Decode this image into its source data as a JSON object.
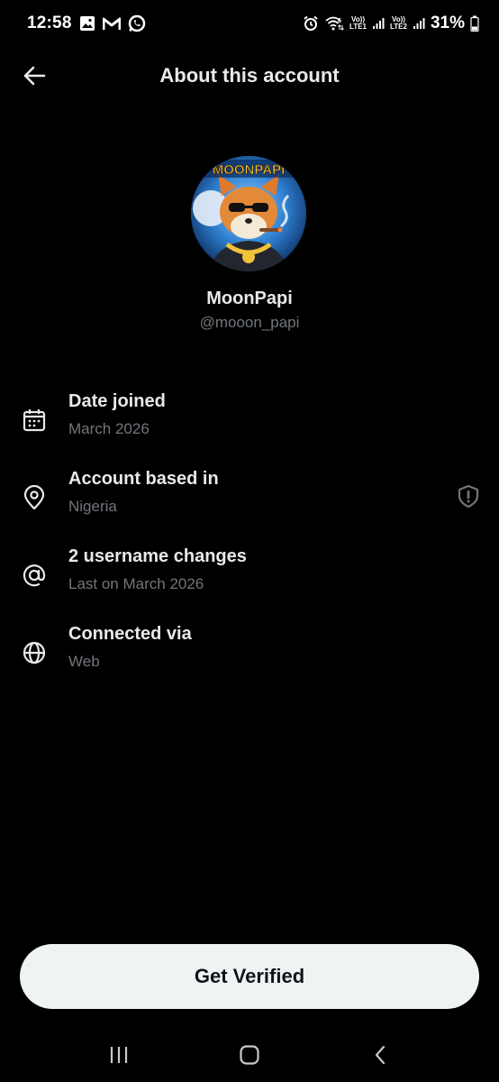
{
  "status_bar": {
    "time": "12:58",
    "network_1": "LTE1",
    "network_2": "LTE2",
    "volte_1": "Vo))",
    "volte_2": "Vo))",
    "wifi_badge": "6",
    "battery": "31%",
    "left_icons": [
      "gallery-icon",
      "gmail-icon",
      "whatsapp-icon"
    ],
    "right_icons": [
      "alarm-icon",
      "wifi-icon",
      "signal-icon",
      "battery-icon"
    ]
  },
  "header": {
    "title": "About this account",
    "back_icon": "arrow-left-icon"
  },
  "profile": {
    "display_name": "MoonPapi",
    "handle": "@mooon_papi",
    "avatar_text": "MOONPAPI"
  },
  "info": [
    {
      "icon": "calendar-icon",
      "title": "Date joined",
      "subtitle": "March 2026"
    },
    {
      "icon": "location-pin-icon",
      "title": "Account based in",
      "subtitle": "Nigeria",
      "trailing_icon": "shield-alert-icon"
    },
    {
      "icon": "at-sign-icon",
      "title": "2 username changes",
      "subtitle": "Last on March 2026"
    },
    {
      "icon": "globe-icon",
      "title": "Connected via",
      "subtitle": "Web"
    }
  ],
  "verify_button": {
    "label": "Get Verified"
  },
  "nav_bar": {
    "items": [
      "recent-apps-icon",
      "home-icon",
      "back-icon"
    ]
  },
  "colors": {
    "background": "#000000",
    "primary_text": "#e7e9ea",
    "secondary_text": "#71767b",
    "button_bg": "#eff3f4",
    "button_text": "#0f1419"
  }
}
